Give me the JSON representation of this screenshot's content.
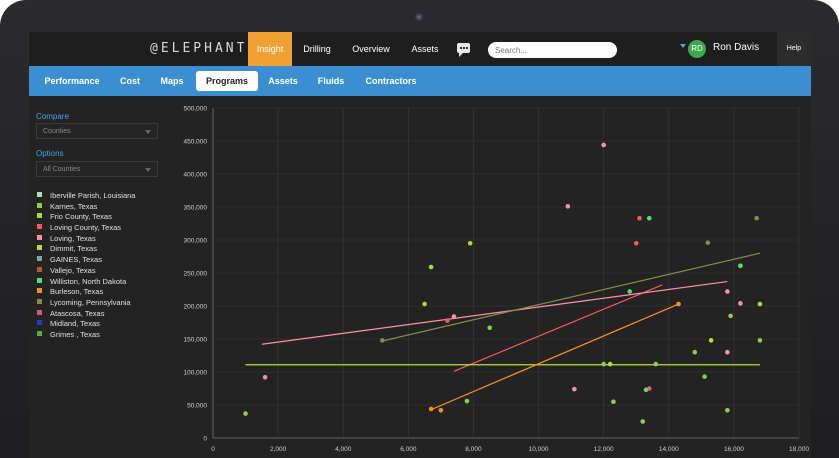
{
  "app": {
    "logo": "@ELEPHANT",
    "nav": [
      {
        "label": "Insight",
        "active": true
      },
      {
        "label": "Drilling",
        "active": false
      },
      {
        "label": "Overview",
        "active": false
      },
      {
        "label": "Assets",
        "active": false
      }
    ],
    "search_placeholder": "Search...",
    "user": {
      "initials": "RD",
      "name": "Ron Davis"
    },
    "help_label": "Help"
  },
  "tabs": [
    {
      "label": "Performance",
      "active": false
    },
    {
      "label": "Cost",
      "active": false
    },
    {
      "label": "Maps",
      "active": false
    },
    {
      "label": "Programs",
      "active": true
    },
    {
      "label": "Assets",
      "active": false
    },
    {
      "label": "Fluids",
      "active": false
    },
    {
      "label": "Contractors",
      "active": false
    }
  ],
  "sidebar": {
    "compare_label": "Compare",
    "compare_value": "Counties",
    "options_label": "Options",
    "options_value": "All Counties"
  },
  "colors": {
    "accent_orange": "#f0a030",
    "subnav_blue": "#3b8fd0",
    "label_blue": "#4aa0e0"
  },
  "chart_data": {
    "type": "scatter",
    "xlim": [
      0,
      18000
    ],
    "ylim": [
      0,
      500000
    ],
    "x_ticks": [
      0,
      2000,
      4000,
      6000,
      8000,
      10000,
      12000,
      14000,
      16000,
      18000
    ],
    "y_ticks": [
      0,
      50000,
      100000,
      150000,
      200000,
      250000,
      300000,
      350000,
      400000,
      450000,
      500000
    ],
    "x_tick_labels": [
      "0",
      "2,000",
      "4,000",
      "6,000",
      "8,000",
      "10,000",
      "12,000",
      "14,000",
      "16,000",
      "18,000"
    ],
    "y_tick_labels": [
      "0",
      "50,000",
      "100,000",
      "150,000",
      "200,000",
      "250,000",
      "300,000",
      "350,000",
      "400,000",
      "450,000",
      "500,000"
    ],
    "grid": true,
    "series": [
      {
        "name": "Iberville Parish, Louisiana",
        "color": "#a8e6a8",
        "points": [],
        "trend": null
      },
      {
        "name": "Karnes, Texas",
        "color": "#8ad04a",
        "points": [
          [
            1000,
            37000
          ],
          [
            7800,
            56000
          ],
          [
            8500,
            167000
          ],
          [
            12000,
            112000
          ],
          [
            12300,
            55000
          ],
          [
            13200,
            25000
          ],
          [
            13600,
            112000
          ],
          [
            14800,
            130000
          ],
          [
            15100,
            93000
          ],
          [
            15800,
            42000
          ],
          [
            15900,
            185000
          ],
          [
            16800,
            148000
          ]
        ],
        "trend": null
      },
      {
        "name": "Frio County, Texas",
        "color": "#a0e030",
        "points": [
          [
            6500,
            203000
          ],
          [
            6700,
            259000
          ],
          [
            7900,
            295000
          ],
          [
            16200,
            261000
          ],
          [
            16800,
            203000
          ]
        ],
        "trend": null
      },
      {
        "name": "Loving County, Texas",
        "color": "#ff5a5a",
        "points": [
          [
            7200,
            178000
          ],
          [
            13000,
            295000
          ],
          [
            13100,
            333000
          ],
          [
            13400,
            75000
          ]
        ],
        "trend": [
          [
            7400,
            101000
          ],
          [
            13800,
            232000
          ]
        ]
      },
      {
        "name": "Loving, Texas",
        "color": "#ff90a8",
        "points": [
          [
            1600,
            92000
          ],
          [
            7400,
            184000
          ],
          [
            10900,
            351000
          ],
          [
            11100,
            74000
          ],
          [
            12000,
            444000
          ],
          [
            15800,
            222000
          ],
          [
            15800,
            130000
          ],
          [
            16200,
            204000
          ]
        ],
        "trend": [
          [
            1500,
            142000
          ],
          [
            15800,
            237000
          ]
        ]
      },
      {
        "name": "Dimmit, Texas",
        "color": "#b8e030",
        "points": [
          [
            12200,
            112000
          ],
          [
            15300,
            148000
          ]
        ],
        "trend": [
          [
            1000,
            111000
          ],
          [
            16800,
            111000
          ]
        ]
      },
      {
        "name": "GAINES, Texas",
        "color": "#7aa8a0",
        "points": [],
        "trend": null
      },
      {
        "name": "Vallejo, Texas",
        "color": "#b05a30",
        "points": [],
        "trend": null
      },
      {
        "name": "Williston, North Dakota",
        "color": "#50e070",
        "points": [
          [
            12800,
            222000
          ],
          [
            13300,
            73000
          ],
          [
            13400,
            333000
          ],
          [
            16200,
            261000
          ]
        ],
        "trend": null
      },
      {
        "name": "Burleson, Texas",
        "color": "#ff9020",
        "points": [
          [
            6700,
            44000
          ],
          [
            7000,
            42000
          ],
          [
            14300,
            203000
          ]
        ],
        "trend": [
          [
            6700,
            43000
          ],
          [
            14300,
            203000
          ]
        ]
      },
      {
        "name": "Lycoming, Pennsylvania",
        "color": "#8a8a4a",
        "points": [
          [
            5200,
            148000
          ],
          [
            15200,
            296000
          ],
          [
            16700,
            333000
          ]
        ],
        "trend": [
          [
            5200,
            147000
          ],
          [
            16800,
            280000
          ]
        ]
      },
      {
        "name": "Atascosa, Texas",
        "color": "#c86070",
        "points": [],
        "trend": null
      },
      {
        "name": "Midland, Texas",
        "color": "#2040c0",
        "points": [],
        "trend": null
      },
      {
        "name": "Grimes , Texas",
        "color": "#50b050",
        "points": [],
        "trend": null
      }
    ]
  }
}
